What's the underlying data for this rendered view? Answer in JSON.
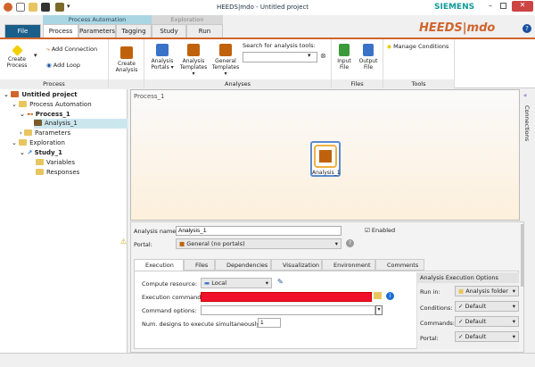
{
  "window": {
    "title": "HEEDS|mdo - Untitled project",
    "brand": "SIEMENS",
    "logo": "HEEDS|mdo"
  },
  "context_groups": {
    "process_automation": "Process Automation",
    "exploration": "Exploration"
  },
  "tabs": [
    "File",
    "Process",
    "Parameters",
    "Tagging",
    "Study",
    "Run"
  ],
  "ribbon": {
    "process": {
      "label": "Process",
      "create_process": "Create Process",
      "add_connection": "Add Connection",
      "add_loop": "Add Loop"
    },
    "create_analysis": "Create Analysis",
    "analyses": {
      "label": "Analyses",
      "portals": "Analysis Portals",
      "templates": "Analysis Templates",
      "general": "General Templates",
      "search_label": "Search for analysis tools:",
      "search_value": ""
    },
    "files": {
      "label": "Files",
      "input": "Input File",
      "output": "Output File"
    },
    "tools": {
      "label": "Tools",
      "manage": "Manage Conditions"
    }
  },
  "tree": {
    "root": "Untitled project",
    "pa": "Process Automation",
    "process": "Process_1",
    "analysis": "Analysis_1",
    "parameters": "Parameters",
    "exploration": "Exploration",
    "study": "Study_1",
    "variables": "Variables",
    "responses": "Responses"
  },
  "canvas": {
    "title": "Process_1",
    "node": "Analysis_1",
    "side": "Connections"
  },
  "panel": {
    "name_label": "Analysis name:",
    "name_value": "Analysis_1",
    "enabled": "Enabled",
    "portal_label": "Portal:",
    "portal_value": "General (no portals)",
    "tabs": [
      "Execution",
      "Files",
      "Dependencies",
      "Visualization",
      "Environment",
      "Comments"
    ],
    "compute_label": "Compute resource:",
    "compute_value": "Local",
    "exec_label": "Execution command:",
    "exec_value": "",
    "opts_label": "Command options:",
    "opts_value": "",
    "num_label": "Num. designs to execute simultaneously:",
    "num_value": "1",
    "options_title": "Analysis Execution Options",
    "run_in_label": "Run in:",
    "run_in": "Analysis folder",
    "conditions_label": "Conditions:",
    "conditions": "Default",
    "commands_label": "Commands:",
    "commands": "Default",
    "portal2_label": "Portal:",
    "portal2": "Default"
  },
  "colors": {
    "accent": "#d0642c",
    "file_tab": "#1a5f8a",
    "error": "#f0102c"
  }
}
